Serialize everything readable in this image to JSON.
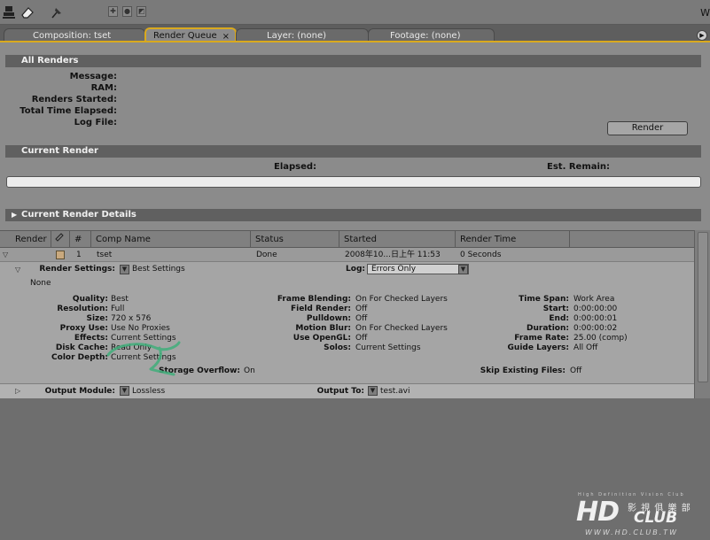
{
  "toolbar": {
    "icons": [
      "stamp-icon",
      "eraser-icon",
      "puppet-pin-icon",
      "axis-mode-icons"
    ],
    "right_label": "W"
  },
  "tabs": [
    {
      "label": "Composition: tset",
      "active": false
    },
    {
      "label": "Render Queue",
      "active": true,
      "close": "×"
    },
    {
      "label": "Layer: (none)",
      "active": false
    },
    {
      "label": "Footage: (none)",
      "active": false
    }
  ],
  "all_renders": {
    "title": "All Renders",
    "labels": [
      "Message:",
      "RAM:",
      "Renders Started:",
      "Total Time Elapsed:",
      "Log File:"
    ],
    "render_button": "Render"
  },
  "current_render": {
    "title": "Current Render",
    "elapsed_label": "Elapsed:",
    "remain_label": "Est. Remain:"
  },
  "current_render_details": {
    "title": "Current Render Details"
  },
  "queue": {
    "columns": [
      "Render",
      "",
      "#",
      "Comp Name",
      "Status",
      "Started",
      "Render Time"
    ],
    "row": {
      "number": "1",
      "comp_name": "tset",
      "status": "Done",
      "started": "2008年10...日上午 11:53",
      "render_time": "0 Seconds"
    },
    "render_settings": {
      "label": "Render Settings:",
      "value": "Best Settings",
      "log_label": "Log:",
      "log_value": "Errors Only",
      "sub": "None",
      "col1": [
        {
          "label": "Quality:",
          "value": "Best"
        },
        {
          "label": "Resolution:",
          "value": "Full"
        },
        {
          "label": "Size:",
          "value": "720 x 576"
        },
        {
          "label": "Proxy Use:",
          "value": "Use No Proxies"
        },
        {
          "label": "Effects:",
          "value": "Current Settings"
        },
        {
          "label": "Disk Cache:",
          "value": "Read Only"
        },
        {
          "label": "Color Depth:",
          "value": "Current Settings"
        }
      ],
      "col2": [
        {
          "label": "Frame Blending:",
          "value": "On For Checked Layers"
        },
        {
          "label": "Field Render:",
          "value": "Off"
        },
        {
          "label": "Pulldown:",
          "value": "Off"
        },
        {
          "label": "Motion Blur:",
          "value": "On For Checked Layers"
        },
        {
          "label": "Use OpenGL:",
          "value": "Off"
        },
        {
          "label": "Solos:",
          "value": "Current Settings"
        }
      ],
      "col3": [
        {
          "label": "Time Span:",
          "value": "Work Area"
        },
        {
          "label": "Start:",
          "value": "0:00:00:00"
        },
        {
          "label": "End:",
          "value": "0:00:00:01"
        },
        {
          "label": "Duration:",
          "value": "0:00:00:02"
        },
        {
          "label": "Frame Rate:",
          "value": "25.00 (comp)"
        },
        {
          "label": "Guide Layers:",
          "value": "All Off"
        }
      ],
      "storage_overflow_label": "Storage Overflow:",
      "storage_overflow_value": "On",
      "skip_existing_label": "Skip Existing Files:",
      "skip_existing_value": "Off"
    },
    "output": {
      "module_label": "Output Module:",
      "module_value": "Lossless",
      "to_label": "Output To:",
      "to_value": "test.avi"
    }
  },
  "watermark": {
    "tagline": "High Definition Vision Club",
    "logo": "HD",
    "logo2": "CLUB",
    "chinese": "影 視 俱 樂 部",
    "url": "WWW.HD.CLUB.TW"
  },
  "colors": {
    "active_tab_border": "#d9a91e",
    "panel_bg": "#8b8b8b",
    "section_header": "#606060",
    "swatch": "#c9a97e",
    "scribble": "#3fae7a"
  }
}
